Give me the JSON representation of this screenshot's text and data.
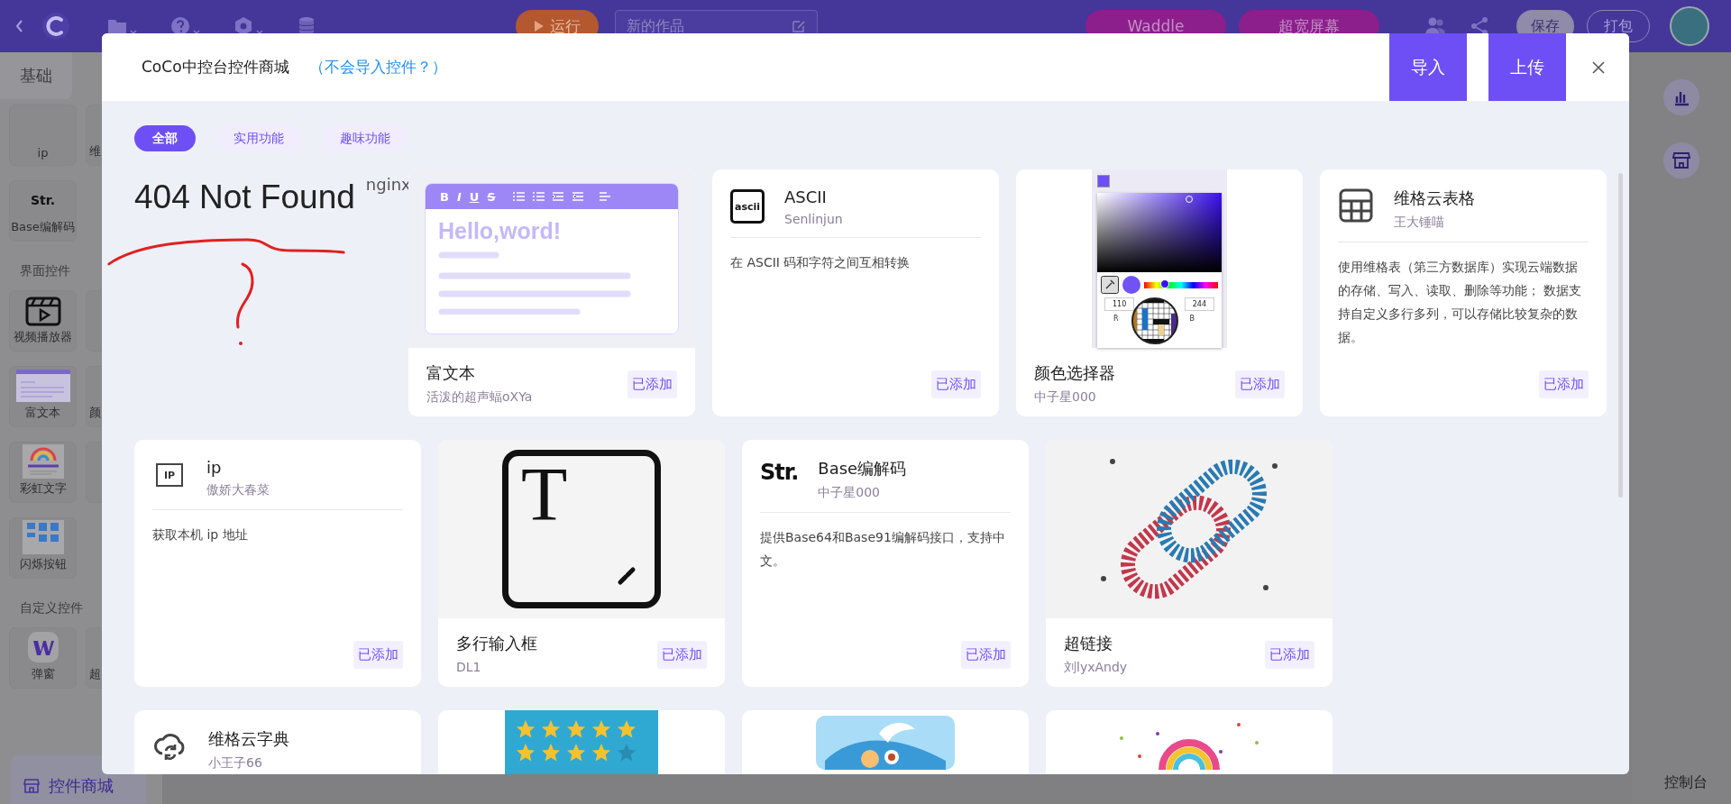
{
  "app_bar": {
    "run_button": "运行",
    "title_field": "新的作品",
    "mode_buttons": [
      "Waddle",
      "超宽屏幕"
    ],
    "save_button": "保存",
    "package_button": "打包"
  },
  "sidebar": {
    "tab": "基础",
    "groups": [
      {
        "items": [
          {
            "label": "ip",
            "kind": "none"
          },
          {
            "label": "维",
            "kind": "none"
          },
          {
            "label": "Base编解码",
            "kind": "str",
            "thumb_text": "Str."
          }
        ]
      },
      {
        "heading": "界面控件",
        "items": [
          {
            "label": "视频播放器",
            "kind": "video"
          },
          {
            "kind": "none"
          },
          {
            "label": "富文本",
            "kind": "editor"
          },
          {
            "label": "颜",
            "kind": "none"
          },
          {
            "label": "彩虹文字",
            "kind": "rainbow"
          },
          {
            "kind": "none"
          },
          {
            "label": "闪烁按钮",
            "kind": "buttons"
          }
        ]
      },
      {
        "heading": "自定义控件",
        "items": [
          {
            "label": "弹窗",
            "kind": "logo"
          },
          {
            "label": "超",
            "kind": "none"
          }
        ]
      }
    ],
    "store_button": "控件商城"
  },
  "right_panel": {
    "console_button": "控制台"
  },
  "modal": {
    "title": "CoCo中控台控件商城",
    "help_link": "（不会导入控件？）",
    "buttons": [
      "导入",
      "上传"
    ],
    "filters": [
      {
        "label": "全部",
        "selected": true
      },
      {
        "label": "实用功能",
        "selected": false
      },
      {
        "label": "趣味功能",
        "selected": false
      }
    ],
    "items": [
      {
        "kind": "error",
        "heading": "404 Not Found",
        "server": "nginx"
      },
      {
        "kind": "image",
        "preview": {
          "kind": "editor",
          "toolbar": [
            "B",
            "I",
            "U",
            "S"
          ],
          "text": "Hello,word!"
        },
        "title": "富文本",
        "author": "活泼的超声蝠oXYa",
        "button": "已添加"
      },
      {
        "kind": "info",
        "icon": {
          "kind": "text",
          "text": "ascii"
        },
        "title": "ASCII",
        "author": "Senlinjun",
        "description": "在 ASCII 码和字符之间互相转换",
        "button": "已添加"
      },
      {
        "kind": "image",
        "preview": {
          "kind": "color-picker",
          "hue": {
            "level": 0.28
          },
          "values": [
            "110",
            "244"
          ],
          "labels": [
            "R",
            "B"
          ]
        },
        "title": "颜色选择器",
        "author": "中子星000",
        "button": "已添加"
      },
      {
        "kind": "info",
        "icon": {
          "kind": "table"
        },
        "title": "维格云表格",
        "author": "王大锤喵",
        "description": "使用维格表（第三方数据库）实现云端数据的存储、写入、读取、删除等功能； 数据支持自定义多行多列，可以存储比较复杂的数据。",
        "button": "已添加"
      },
      {
        "kind": "info",
        "icon": {
          "kind": "sign",
          "text": "IP"
        },
        "title": "ip",
        "author": "傲娇大春菜",
        "description": "获取本机 ip 地址",
        "button": "已添加"
      },
      {
        "kind": "image",
        "preview": {
          "kind": "glyph",
          "text": "T"
        },
        "title": "多行输入框",
        "author": "DL1",
        "button": "已添加"
      },
      {
        "kind": "info",
        "icon": {
          "kind": "plain",
          "text": "Str."
        },
        "title": "Base编解码",
        "author": "中子星000",
        "description": "提供Base64和Base91编解码接口，支持中文。",
        "button": "已添加"
      },
      {
        "kind": "image",
        "preview": {
          "kind": "photo"
        },
        "title": "超链接",
        "author": "刘lyxAndy",
        "button": "已添加"
      },
      {
        "kind": "info",
        "icon": {
          "kind": "cloud"
        },
        "title": "维格云字典",
        "author": "小王子66"
      },
      {
        "kind": "image",
        "preview": {
          "kind": "stars",
          "rows": [
            {
              "stars": 5
            },
            {
              "stars": 4
            }
          ]
        }
      },
      {
        "kind": "image",
        "preview": {
          "kind": "cartoon"
        }
      },
      {
        "kind": "image",
        "preview": {
          "kind": "rainbow"
        }
      }
    ]
  }
}
